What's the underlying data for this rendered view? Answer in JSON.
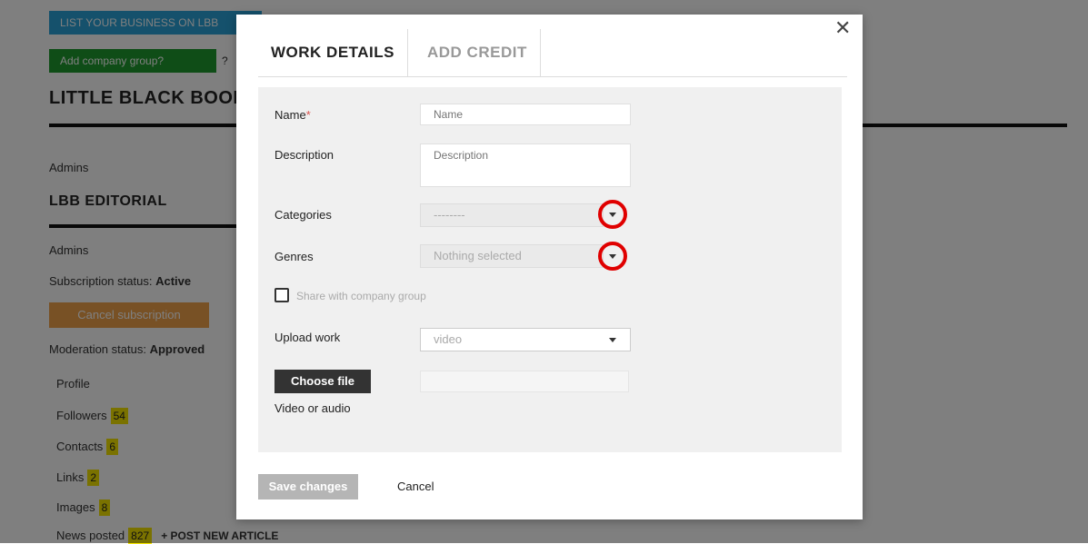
{
  "background": {
    "list_business_button": "LIST YOUR BUSINESS ON LBB",
    "add_group_button": "Add company group?",
    "help_mark": "?",
    "company_title": "LITTLE BLACK BOOK",
    "admins_label_1": "Admins",
    "section_title": "LBB EDITORIAL",
    "admins_label_2": "Admins",
    "subscription_label": "Subscription status:",
    "subscription_value": "Active",
    "cancel_subscription_button": "Cancel subscription",
    "moderation_label": "Moderation status:",
    "moderation_value": "Approved",
    "menu": [
      {
        "label": "Profile",
        "count": ""
      },
      {
        "label": "Followers",
        "count": "54"
      },
      {
        "label": "Contacts",
        "count": "6"
      },
      {
        "label": "Links",
        "count": "2"
      },
      {
        "label": "Images",
        "count": "8"
      },
      {
        "label": "News posted",
        "count": "827"
      }
    ],
    "post_new_article": "+ POST NEW ARTICLE"
  },
  "modal": {
    "close_symbol": "✕",
    "tabs": [
      {
        "label": "WORK DETAILS",
        "active": true
      },
      {
        "label": "ADD CREDIT",
        "active": false
      }
    ],
    "form": {
      "name_label": "Name",
      "required_mark": "*",
      "name_placeholder": "Name",
      "description_label": "Description",
      "description_placeholder": "Description",
      "categories_label": "Categories",
      "categories_value": "--------",
      "genres_label": "Genres",
      "genres_value": "Nothing selected",
      "share_label": "Share with company group",
      "upload_label": "Upload work",
      "upload_value": "video",
      "choose_file_button": "Choose file",
      "file_hint": "Video or audio"
    },
    "save_button": "Save changes",
    "cancel_button": "Cancel"
  },
  "colors": {
    "overlay": "rgba(0,0,0,0.5)",
    "highlight_circle": "#e00000",
    "badge": "#f5e400"
  }
}
